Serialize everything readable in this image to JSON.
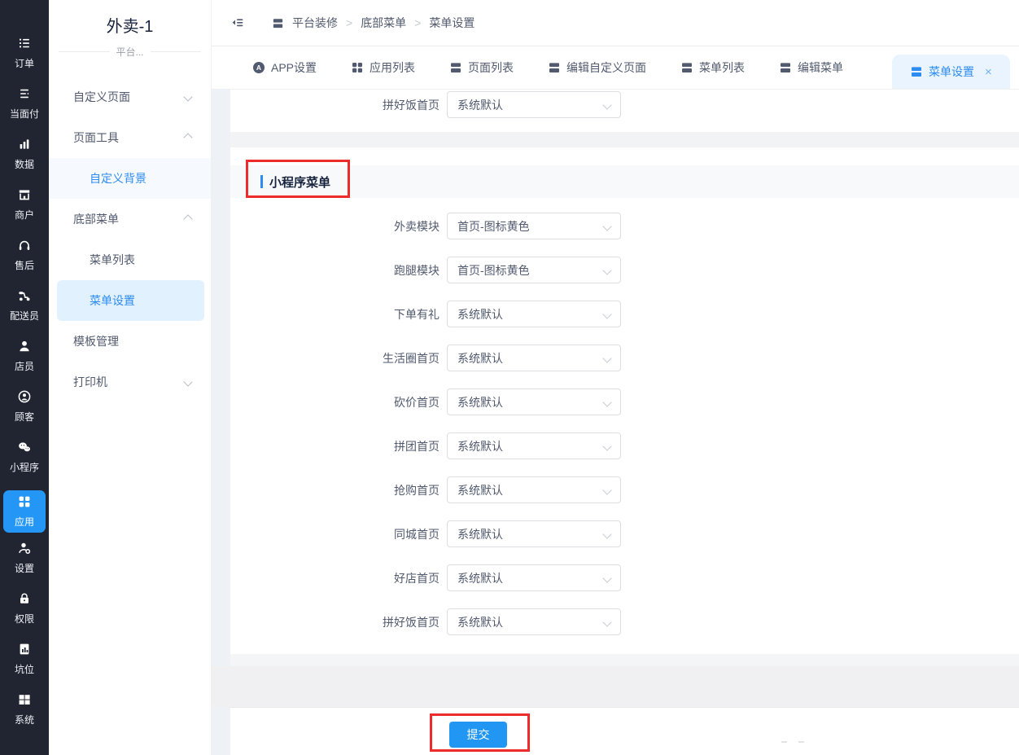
{
  "left_rail": {
    "items": [
      {
        "label": "订单",
        "icon": "order-list-icon",
        "active": false
      },
      {
        "label": "当面付",
        "icon": "face-pay-list-icon",
        "active": false
      },
      {
        "label": "数据",
        "icon": "data-chart-icon",
        "active": false
      },
      {
        "label": "商户",
        "icon": "merchant-shop-icon",
        "active": false
      },
      {
        "label": "售后",
        "icon": "after-sale-headset-icon",
        "active": false
      },
      {
        "label": "配送员",
        "icon": "courier-scooter-icon",
        "active": false
      },
      {
        "label": "店员",
        "icon": "clerk-user-icon",
        "active": false
      },
      {
        "label": "顾客",
        "icon": "customer-circle-icon",
        "active": false
      },
      {
        "label": "小程序",
        "icon": "mini-program-wechat-icon",
        "active": false
      },
      {
        "label": "应用",
        "icon": "apps-grid-icon",
        "active": true
      },
      {
        "label": "设置",
        "icon": "settings-user-icon",
        "active": false
      },
      {
        "label": "权限",
        "icon": "permission-lock-icon",
        "active": false
      },
      {
        "label": "坑位",
        "icon": "slot-doc-chart-icon",
        "active": false
      },
      {
        "label": "系统",
        "icon": "system-windows-icon",
        "active": false
      }
    ]
  },
  "sidebar": {
    "title": "外卖-1",
    "subtitle": "平台...",
    "items": [
      {
        "label": "自定义页面",
        "type": "group",
        "chevron": "down"
      },
      {
        "label": "页面工具",
        "type": "group",
        "chevron": "up"
      },
      {
        "label": "自定义背景",
        "type": "sub",
        "state": "hover"
      },
      {
        "label": "底部菜单",
        "type": "group",
        "chevron": "up"
      },
      {
        "label": "菜单列表",
        "type": "sub"
      },
      {
        "label": "菜单设置",
        "type": "sub",
        "state": "active"
      },
      {
        "label": "模板管理",
        "type": "group"
      },
      {
        "label": "打印机",
        "type": "group",
        "chevron": "down"
      }
    ]
  },
  "breadcrumb": {
    "separator": ">",
    "items": [
      "平台装修",
      "底部菜单",
      "菜单设置"
    ]
  },
  "tabs": {
    "close_glyph": "×",
    "items": [
      {
        "label": "APP设置",
        "icon": "app-circle-icon",
        "icon_letter": "A",
        "active": false
      },
      {
        "label": "应用列表",
        "icon": "grid-icon",
        "active": false
      },
      {
        "label": "页面列表",
        "icon": "layout-icon",
        "active": false
      },
      {
        "label": "编辑自定义页面",
        "icon": "layout-icon",
        "active": false
      },
      {
        "label": "菜单列表",
        "icon": "layout-icon",
        "active": false
      },
      {
        "label": "编辑菜单",
        "icon": "layout-icon",
        "active": false
      },
      {
        "label": "菜单设置",
        "icon": "layout-icon",
        "active": true,
        "closable": true
      }
    ]
  },
  "form": {
    "top_row": {
      "label": "拼好饭首页",
      "value": "系统默认"
    },
    "section_title": "小程序菜单",
    "rows": [
      {
        "label": "外卖模块",
        "value": "首页-图标黄色"
      },
      {
        "label": "跑腿模块",
        "value": "首页-图标黄色"
      },
      {
        "label": "下单有礼",
        "value": "系统默认"
      },
      {
        "label": "生活圈首页",
        "value": "系统默认"
      },
      {
        "label": "砍价首页",
        "value": "系统默认"
      },
      {
        "label": "拼团首页",
        "value": "系统默认"
      },
      {
        "label": "抢购首页",
        "value": "系统默认"
      },
      {
        "label": "同城首页",
        "value": "系统默认"
      },
      {
        "label": "好店首页",
        "value": "系统默认"
      },
      {
        "label": "拼好饭首页",
        "value": "系统默认"
      }
    ],
    "submit_label": "提交"
  },
  "colors": {
    "accent": "#2d8cf0",
    "rail_active": "#2496f5",
    "submit_blue": "#2196f3",
    "annotation_red": "#ed2b2b",
    "rail_bg": "#202531"
  }
}
